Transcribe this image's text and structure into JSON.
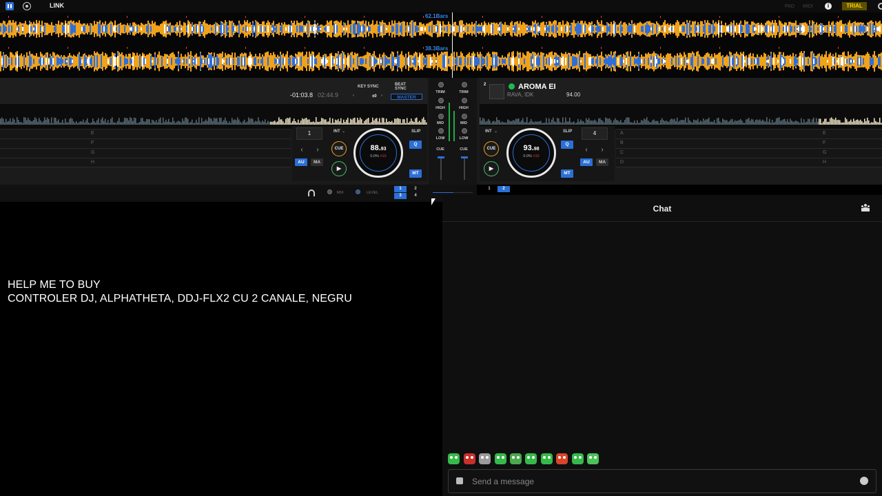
{
  "topbar": {
    "link_label": "LINK",
    "pad_label": "PAD",
    "midi_label": "MIDI",
    "trial_label": "TRIAL",
    "icons": [
      "mixer-grid-icon",
      "record-icon",
      "info-icon",
      "gear-icon"
    ]
  },
  "waveform": {
    "deck1_bars": "62.1Bars",
    "deck2_bars": "38.3Bars",
    "colors": {
      "low": "#2f6ed8",
      "mid": "#f0a21b",
      "high": "#ffffff",
      "beat_marker": "#e03c3c"
    }
  },
  "deck1": {
    "time_remaining": "-01:03.8",
    "time_total": "02:44.9",
    "key_sync_label": "KEY SYNC",
    "key_value": "±0",
    "beat_sync_label": "BEAT SYNC",
    "master_label": "MASTER",
    "loop_number": "1",
    "int_label": "INT",
    "slip_label": "SLIP",
    "q_label": "Q",
    "mt_label": "MT",
    "au_label": "AU",
    "ma_label": "MA",
    "cue_label": "CUE",
    "bpm_int": "88.",
    "bpm_dec": "93",
    "pitch_value": "0.0%",
    "pitch_range": "±10",
    "hotcues": [
      "E",
      "F",
      "G",
      "H"
    ]
  },
  "deck2": {
    "deck_number": "2",
    "track_title": "AROMA EI",
    "artist": "RAVA, IDK",
    "track_bpm": "94.00",
    "loop_number": "4",
    "int_label": "INT",
    "slip_label": "SLIP",
    "q_label": "Q",
    "mt_label": "MT",
    "au_label": "AU",
    "ma_label": "MA",
    "cue_label": "CUE",
    "bpm_int": "93.",
    "bpm_dec": "98",
    "pitch_value": "0.0%",
    "pitch_range": "±10",
    "hotcues_left": [
      "A",
      "B",
      "C",
      "D"
    ],
    "hotcues_right": [
      "E",
      "F",
      "G",
      "H"
    ]
  },
  "mixer": {
    "trim_label": "TRIM",
    "high_label": "HIGH",
    "mid_label": "MID",
    "low_label": "LOW",
    "cue_label": "CUE"
  },
  "headphone_strip": {
    "mix_label": "MIX",
    "level_label": "LEVEL",
    "left_channels": [
      "1",
      "2",
      "3",
      "4"
    ],
    "right_channels": [
      "1",
      "2"
    ]
  },
  "video": {
    "line1": "HELP ME TO BUY",
    "line2": "CONTROLER DJ, ALPHATHETA, DDJ-FLX2 CU 2 CANALE, NEGRU"
  },
  "chat": {
    "title": "Chat",
    "input_placeholder": "Send a message",
    "emotes": [
      "emote-1",
      "emote-2",
      "emote-3",
      "emote-4",
      "emote-5",
      "emote-6",
      "emote-7",
      "emote-8",
      "emote-9",
      "emote-10"
    ]
  }
}
